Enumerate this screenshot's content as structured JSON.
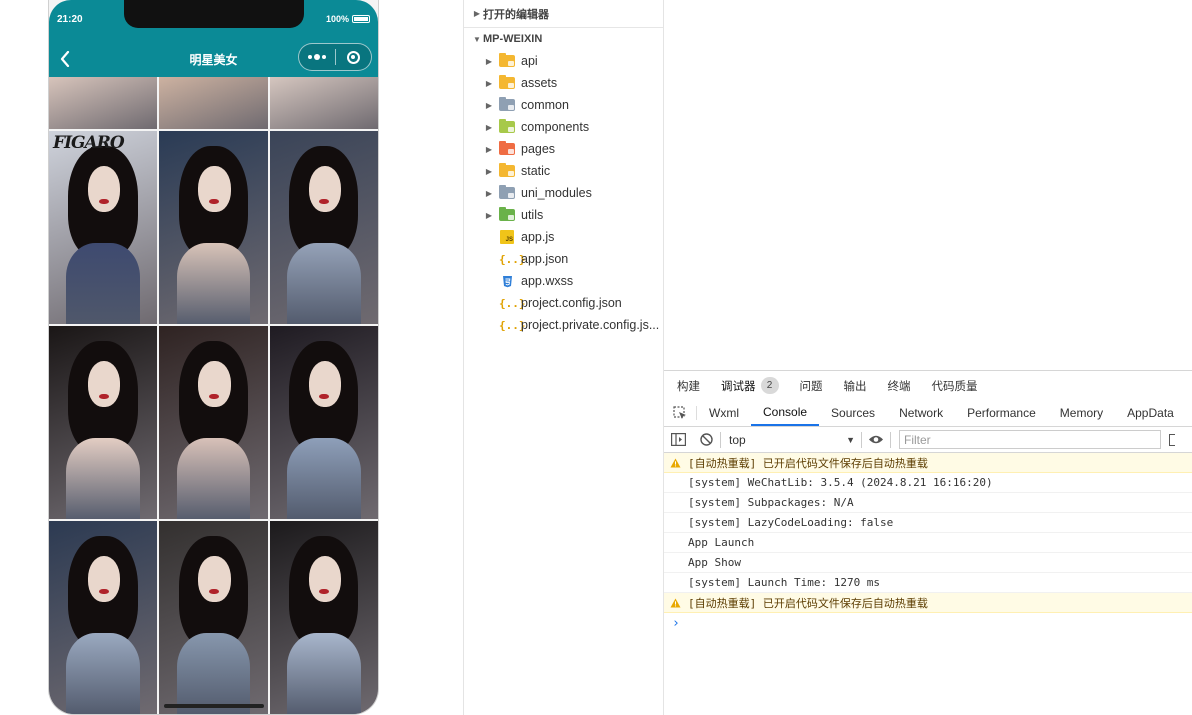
{
  "simulator": {
    "status_time": "21:20",
    "status_battery": "100%",
    "nav_title": "明星美女",
    "photos": [
      {
        "bg": "#d7c4bb",
        "dress": "#9aa3b3",
        "kind": "partial"
      },
      {
        "bg": "#cdb2a1",
        "dress": "#8f8a95",
        "kind": "partial"
      },
      {
        "bg": "#d5c6bf",
        "dress": "#a6acb8",
        "kind": "partial"
      },
      {
        "bg": "#cfd3dc",
        "dress": "#3e4a70",
        "kind": "full"
      },
      {
        "bg": "#2a3b55",
        "dress": "#d8c3b8",
        "kind": "full"
      },
      {
        "bg": "#3a4458",
        "dress": "#95a2b8",
        "kind": "full"
      },
      {
        "bg": "#1a1616",
        "dress": "#e3cdc3",
        "kind": "full"
      },
      {
        "bg": "#2f2322",
        "dress": "#d8c1b8",
        "kind": "full"
      },
      {
        "bg": "#1f1b22",
        "dress": "#8e9fb9",
        "kind": "full"
      },
      {
        "bg": "#2c3a52",
        "dress": "#9aa9c0",
        "kind": "full"
      },
      {
        "bg": "#33302f",
        "dress": "#8797ad",
        "kind": "full"
      },
      {
        "bg": "#1c1a1c",
        "dress": "#a8b6cc",
        "kind": "full"
      }
    ],
    "figaro_text": "FIGARO"
  },
  "explorer": {
    "open_editors_label": "打开的编辑器",
    "project_label": "MP-WEIXIN",
    "folders": [
      {
        "name": "api",
        "color": "#f4b731"
      },
      {
        "name": "assets",
        "color": "#f4b731"
      },
      {
        "name": "common",
        "color": "#8fa0b3"
      },
      {
        "name": "components",
        "color": "#a7c94a"
      },
      {
        "name": "pages",
        "color": "#ef6c43"
      },
      {
        "name": "static",
        "color": "#f4b731"
      },
      {
        "name": "uni_modules",
        "color": "#8fa0b3"
      },
      {
        "name": "utils",
        "color": "#6ab24a"
      }
    ],
    "files": [
      {
        "name": "app.js",
        "type": "js"
      },
      {
        "name": "app.json",
        "type": "json"
      },
      {
        "name": "app.wxss",
        "type": "css"
      },
      {
        "name": "project.config.json",
        "type": "json"
      },
      {
        "name": "project.private.config.js...",
        "type": "json"
      }
    ]
  },
  "devtools": {
    "top_tabs": [
      {
        "label": "构建"
      },
      {
        "label": "调试器",
        "badge": "2"
      },
      {
        "label": "问题"
      },
      {
        "label": "输出"
      },
      {
        "label": "终端"
      },
      {
        "label": "代码质量"
      }
    ],
    "panel_tabs": [
      "Wxml",
      "Console",
      "Sources",
      "Network",
      "Performance",
      "Memory",
      "AppData"
    ],
    "active_panel": "Console",
    "context": "top",
    "filter_placeholder": "Filter",
    "logs": [
      {
        "level": "warn",
        "text": "[自动热重载] 已开启代码文件保存后自动热重载"
      },
      {
        "level": "info",
        "text": "[system] WeChatLib: 3.5.4 (2024.8.21 16:16:20)"
      },
      {
        "level": "info",
        "text": "[system] Subpackages: N/A"
      },
      {
        "level": "info",
        "text": "[system] LazyCodeLoading: false"
      },
      {
        "level": "info",
        "text": "App Launch"
      },
      {
        "level": "info",
        "text": "App Show"
      },
      {
        "level": "info",
        "text": "[system] Launch Time: 1270 ms"
      },
      {
        "level": "warn",
        "text": "[自动热重载] 已开启代码文件保存后自动热重载"
      }
    ],
    "prompt": "›"
  },
  "colors": {
    "nav_bar": "#0b8a96",
    "active_tab_underline": "#1a73e8",
    "warn_bg": "#fffbe5"
  }
}
